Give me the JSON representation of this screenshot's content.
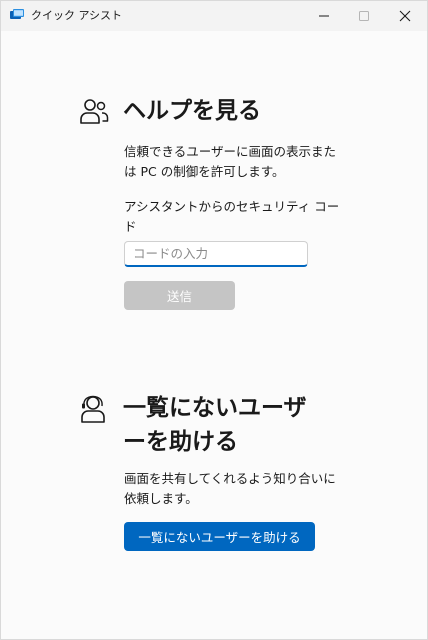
{
  "window": {
    "title": "クイック アシスト",
    "icon": "quick-assist-app-icon",
    "controls": [
      "minimize-icon",
      "maximize-icon",
      "close-icon"
    ]
  },
  "get_help": {
    "icon": "people-icon",
    "heading": "ヘルプを見る",
    "description_lines": [
      "信頼できるユーザーに画面の表示また",
      "は PC の制御を許可します。"
    ],
    "code_label_lines": [
      "アシスタントからのセキュリティ コー",
      "ド"
    ],
    "code_input": {
      "value": "",
      "placeholder": "コードの入力"
    },
    "submit_label": "送信",
    "submit_enabled": false
  },
  "help_someone": {
    "icon": "person-support-icon",
    "heading_lines": [
      "一覧にないユーザ",
      "ーを助ける"
    ],
    "description_lines": [
      "画面を共有してくれるよう知り合いに",
      "依頼します。"
    ],
    "button_label": "一覧にないユーザーを助ける"
  },
  "colors": {
    "accent": "#0067c0",
    "disabled_button": "#c5c5c5",
    "background": "#fbfbfb",
    "titlebar": "#f3f3f3"
  }
}
